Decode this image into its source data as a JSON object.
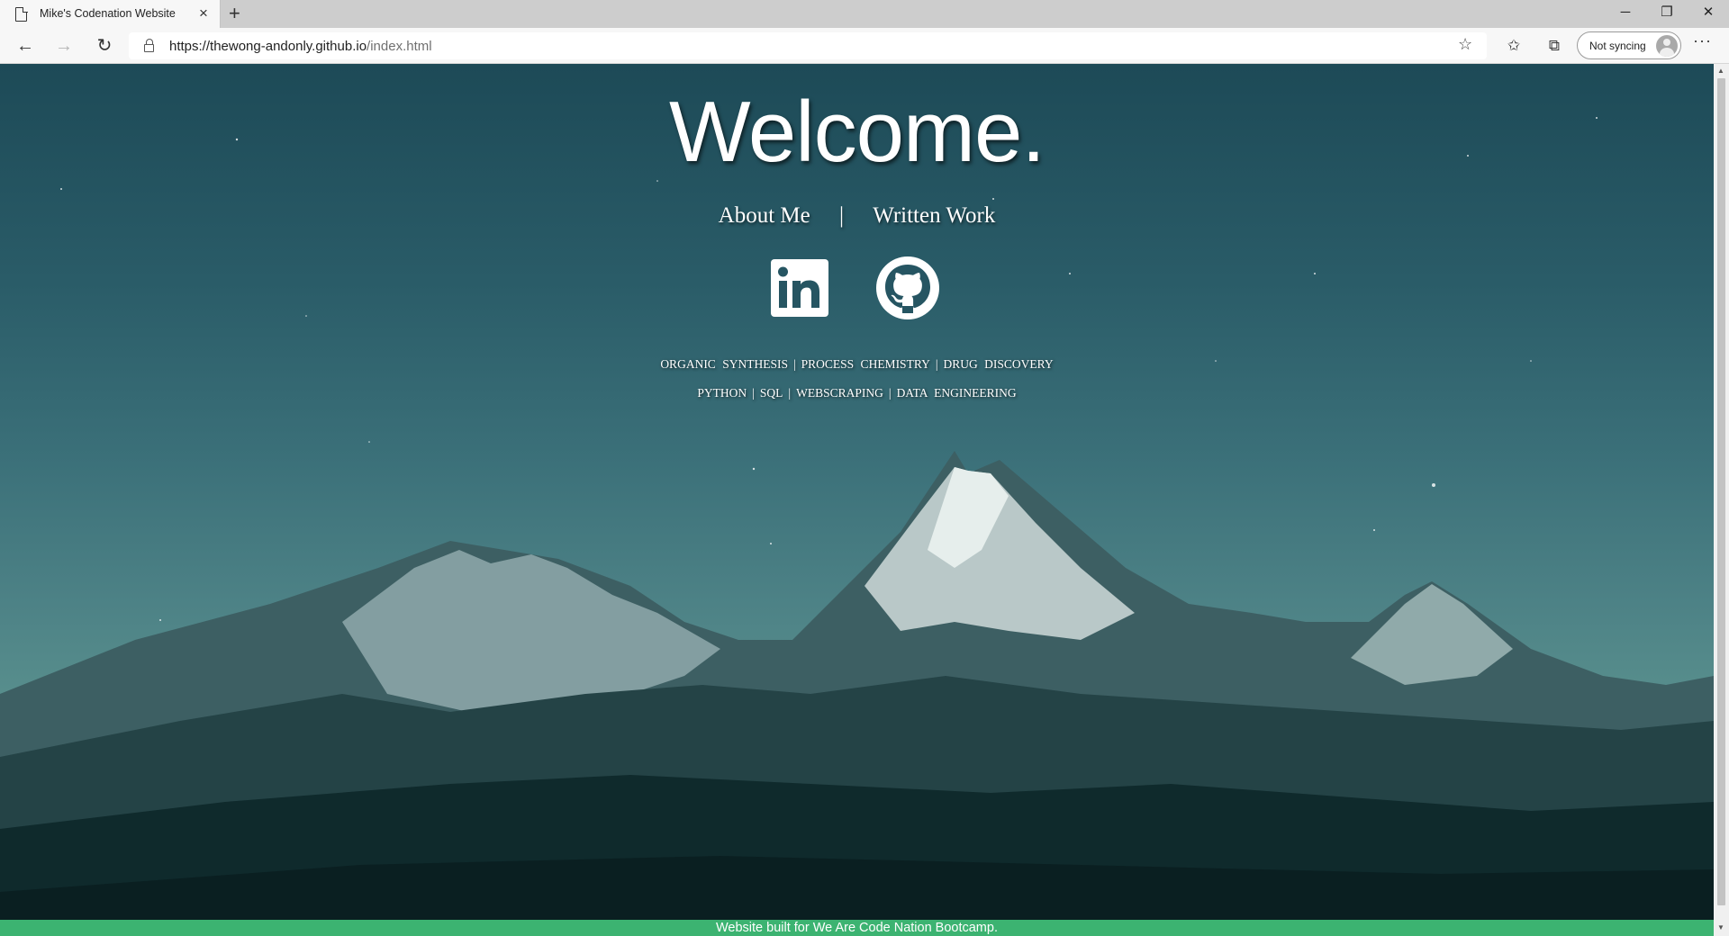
{
  "browser": {
    "tab_title": "Mike's Codenation Website",
    "tab_close_icon": "×",
    "new_tab_icon": "+",
    "url_host": "https://thewong-andonly.github.io",
    "url_path": "/index.html",
    "sync_label": "Not syncing",
    "more_icon": "···",
    "minimize_icon": "─",
    "restore_icon": "❐",
    "close_icon": "✕",
    "back_icon": "←",
    "forward_icon": "→",
    "reload_icon": "↻",
    "star_icon": "☆",
    "favorites_icon": "✩",
    "collections_icon": "⧉"
  },
  "page": {
    "heading": "Welcome.",
    "nav": {
      "about": "About Me",
      "separator": "|",
      "written": "Written Work"
    },
    "social": [
      {
        "name": "linkedin",
        "label": "in"
      },
      {
        "name": "github"
      }
    ],
    "tags_row1": [
      "ORGANIC SYNTHESIS",
      "PROCESS CHEMISTRY",
      "DRUG DISCOVERY"
    ],
    "tags_row2": [
      "PYTHON",
      "SQL",
      "WEBSCRAPING",
      "DATA ENGINEERING"
    ],
    "tag_separator": "|",
    "footer": "Website built for We Are Code Nation Bootcamp."
  },
  "colors": {
    "footer": "#3cb371",
    "sky_top": "#1d4a57",
    "sky_bottom": "#6aa097"
  }
}
